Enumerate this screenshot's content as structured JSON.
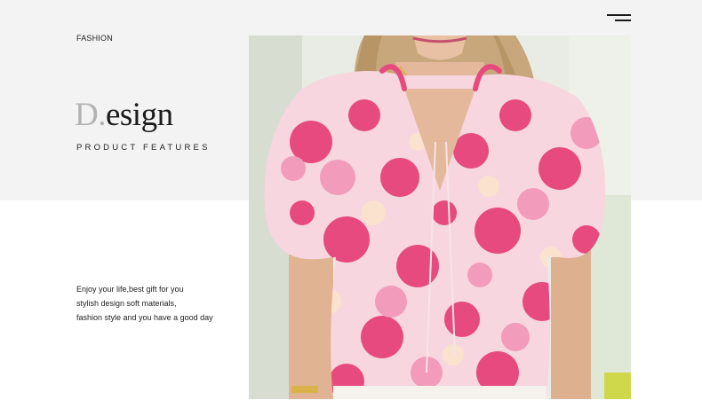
{
  "header": {
    "menu_icon": "hamburger-menu-icon"
  },
  "hero": {
    "kicker": "FASHION",
    "title_initial": "D.",
    "title_rest": "esign",
    "subtitle": "PRODUCT FEATURES"
  },
  "description": {
    "lines": [
      "Enjoy your life,best gift for you",
      "stylish design soft materials,",
      "fashion style and you have a good day"
    ]
  },
  "photo": {
    "subject": "woman wearing pink floral puff-sleeve blouse"
  },
  "colors": {
    "band": "#f3f3f3",
    "title_accent": "#b3b3b3",
    "blouse_pink": "#e64a7e",
    "blouse_light": "#f7c7d6"
  }
}
